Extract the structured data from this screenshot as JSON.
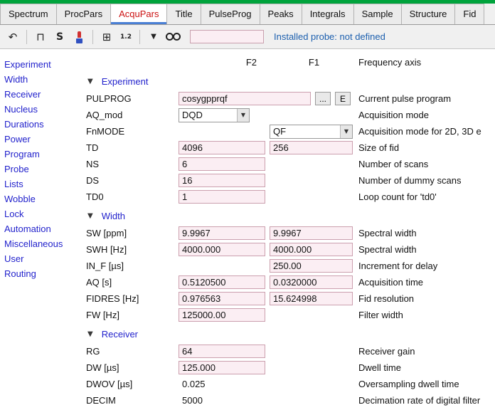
{
  "tabs": {
    "items": [
      "Spectrum",
      "ProcPars",
      "AcquPars",
      "Title",
      "PulseProg",
      "Peaks",
      "Integrals",
      "Sample",
      "Structure",
      "Fid"
    ],
    "active": "AcquPars",
    "active_color": "#cc1111"
  },
  "toolbar": {
    "icons": [
      {
        "name": "undo-icon",
        "glyph": "↶"
      },
      {
        "name": "separator"
      },
      {
        "name": "pulse-icon",
        "glyph": "⊓"
      },
      {
        "name": "s-icon",
        "glyph": "S"
      },
      {
        "name": "probe-icon",
        "glyph": ""
      },
      {
        "name": "separator"
      },
      {
        "name": "matrix-icon",
        "glyph": "⊞"
      },
      {
        "name": "numbering-icon",
        "glyph": "1.2"
      },
      {
        "name": "separator"
      },
      {
        "name": "dropdown-icon",
        "glyph": "▼"
      },
      {
        "name": "search-icon",
        "glyph": ""
      }
    ],
    "search_value": "",
    "probe_status": "Installed probe: not defined",
    "probe_status_color": "#1c5fae"
  },
  "sidebar": {
    "items": [
      "Experiment",
      "Width",
      "Receiver",
      "Nucleus",
      "Durations",
      "Power",
      "Program",
      "Probe",
      "Lists",
      "Wobble",
      "Lock",
      "Automation",
      "Miscellaneous",
      "User",
      "Routing"
    ],
    "link_color": "#2222cc"
  },
  "columns": {
    "f2": "F2",
    "f1": "F1",
    "axis": "Frequency axis"
  },
  "field_color": "#fbeef3",
  "sections": [
    {
      "title": "Experiment",
      "rows": [
        {
          "label": "PULPROG",
          "f2": {
            "type": "input",
            "value": "cosygpprqf",
            "wide": true,
            "buttons": [
              "...",
              "E"
            ]
          },
          "f1": null,
          "desc": "Current pulse program"
        },
        {
          "label": "AQ_mod",
          "f2": {
            "type": "combo",
            "value": "DQD"
          },
          "f1": null,
          "desc": "Acquisition mode"
        },
        {
          "label": "FnMODE",
          "f2": null,
          "f1": {
            "type": "combo",
            "value": "QF"
          },
          "desc": "Acquisition mode for 2D, 3D e"
        },
        {
          "label": "TD",
          "f2": {
            "type": "input",
            "value": "4096"
          },
          "f1": {
            "type": "input",
            "value": "256"
          },
          "desc": "Size of fid"
        },
        {
          "label": "NS",
          "f2": {
            "type": "input",
            "value": "6"
          },
          "f1": null,
          "desc": "Number of scans"
        },
        {
          "label": "DS",
          "f2": {
            "type": "input",
            "value": "16"
          },
          "f1": null,
          "desc": "Number of dummy scans"
        },
        {
          "label": "TD0",
          "f2": {
            "type": "input",
            "value": "1"
          },
          "f1": null,
          "desc": "Loop count for 'td0'"
        }
      ]
    },
    {
      "title": "Width",
      "rows": [
        {
          "label": "SW [ppm]",
          "f2": {
            "type": "input",
            "value": "9.9967"
          },
          "f1": {
            "type": "input",
            "value": "9.9967"
          },
          "desc": "Spectral width"
        },
        {
          "label": "SWH [Hz]",
          "f2": {
            "type": "input",
            "value": "4000.000"
          },
          "f1": {
            "type": "input",
            "value": "4000.000"
          },
          "desc": "Spectral width"
        },
        {
          "label": "IN_F [µs]",
          "f2": null,
          "f1": {
            "type": "input",
            "value": "250.00"
          },
          "desc": "Increment for delay"
        },
        {
          "label": "AQ [s]",
          "f2": {
            "type": "input",
            "value": "0.5120500"
          },
          "f1": {
            "type": "input",
            "value": "0.0320000"
          },
          "desc": "Acquisition time"
        },
        {
          "label": "FIDRES [Hz]",
          "f2": {
            "type": "input",
            "value": "0.976563"
          },
          "f1": {
            "type": "input",
            "value": "15.624998"
          },
          "desc": "Fid resolution"
        },
        {
          "label": "FW [Hz]",
          "f2": {
            "type": "input",
            "value": "125000.00"
          },
          "f1": null,
          "desc": "Filter width"
        }
      ]
    },
    {
      "title": "Receiver",
      "rows": [
        {
          "label": "RG",
          "f2": {
            "type": "input",
            "value": "64"
          },
          "f1": null,
          "desc": "Receiver gain"
        },
        {
          "label": "DW [µs]",
          "f2": {
            "type": "input",
            "value": "125.000"
          },
          "f1": null,
          "desc": "Dwell time"
        },
        {
          "label": "DWOV [µs]",
          "f2": {
            "type": "text",
            "value": "0.025"
          },
          "f1": null,
          "desc": "Oversampling dwell time"
        },
        {
          "label": "DECIM",
          "f2": {
            "type": "text",
            "value": "5000"
          },
          "f1": null,
          "desc": "Decimation rate of digital filter"
        }
      ]
    }
  ]
}
